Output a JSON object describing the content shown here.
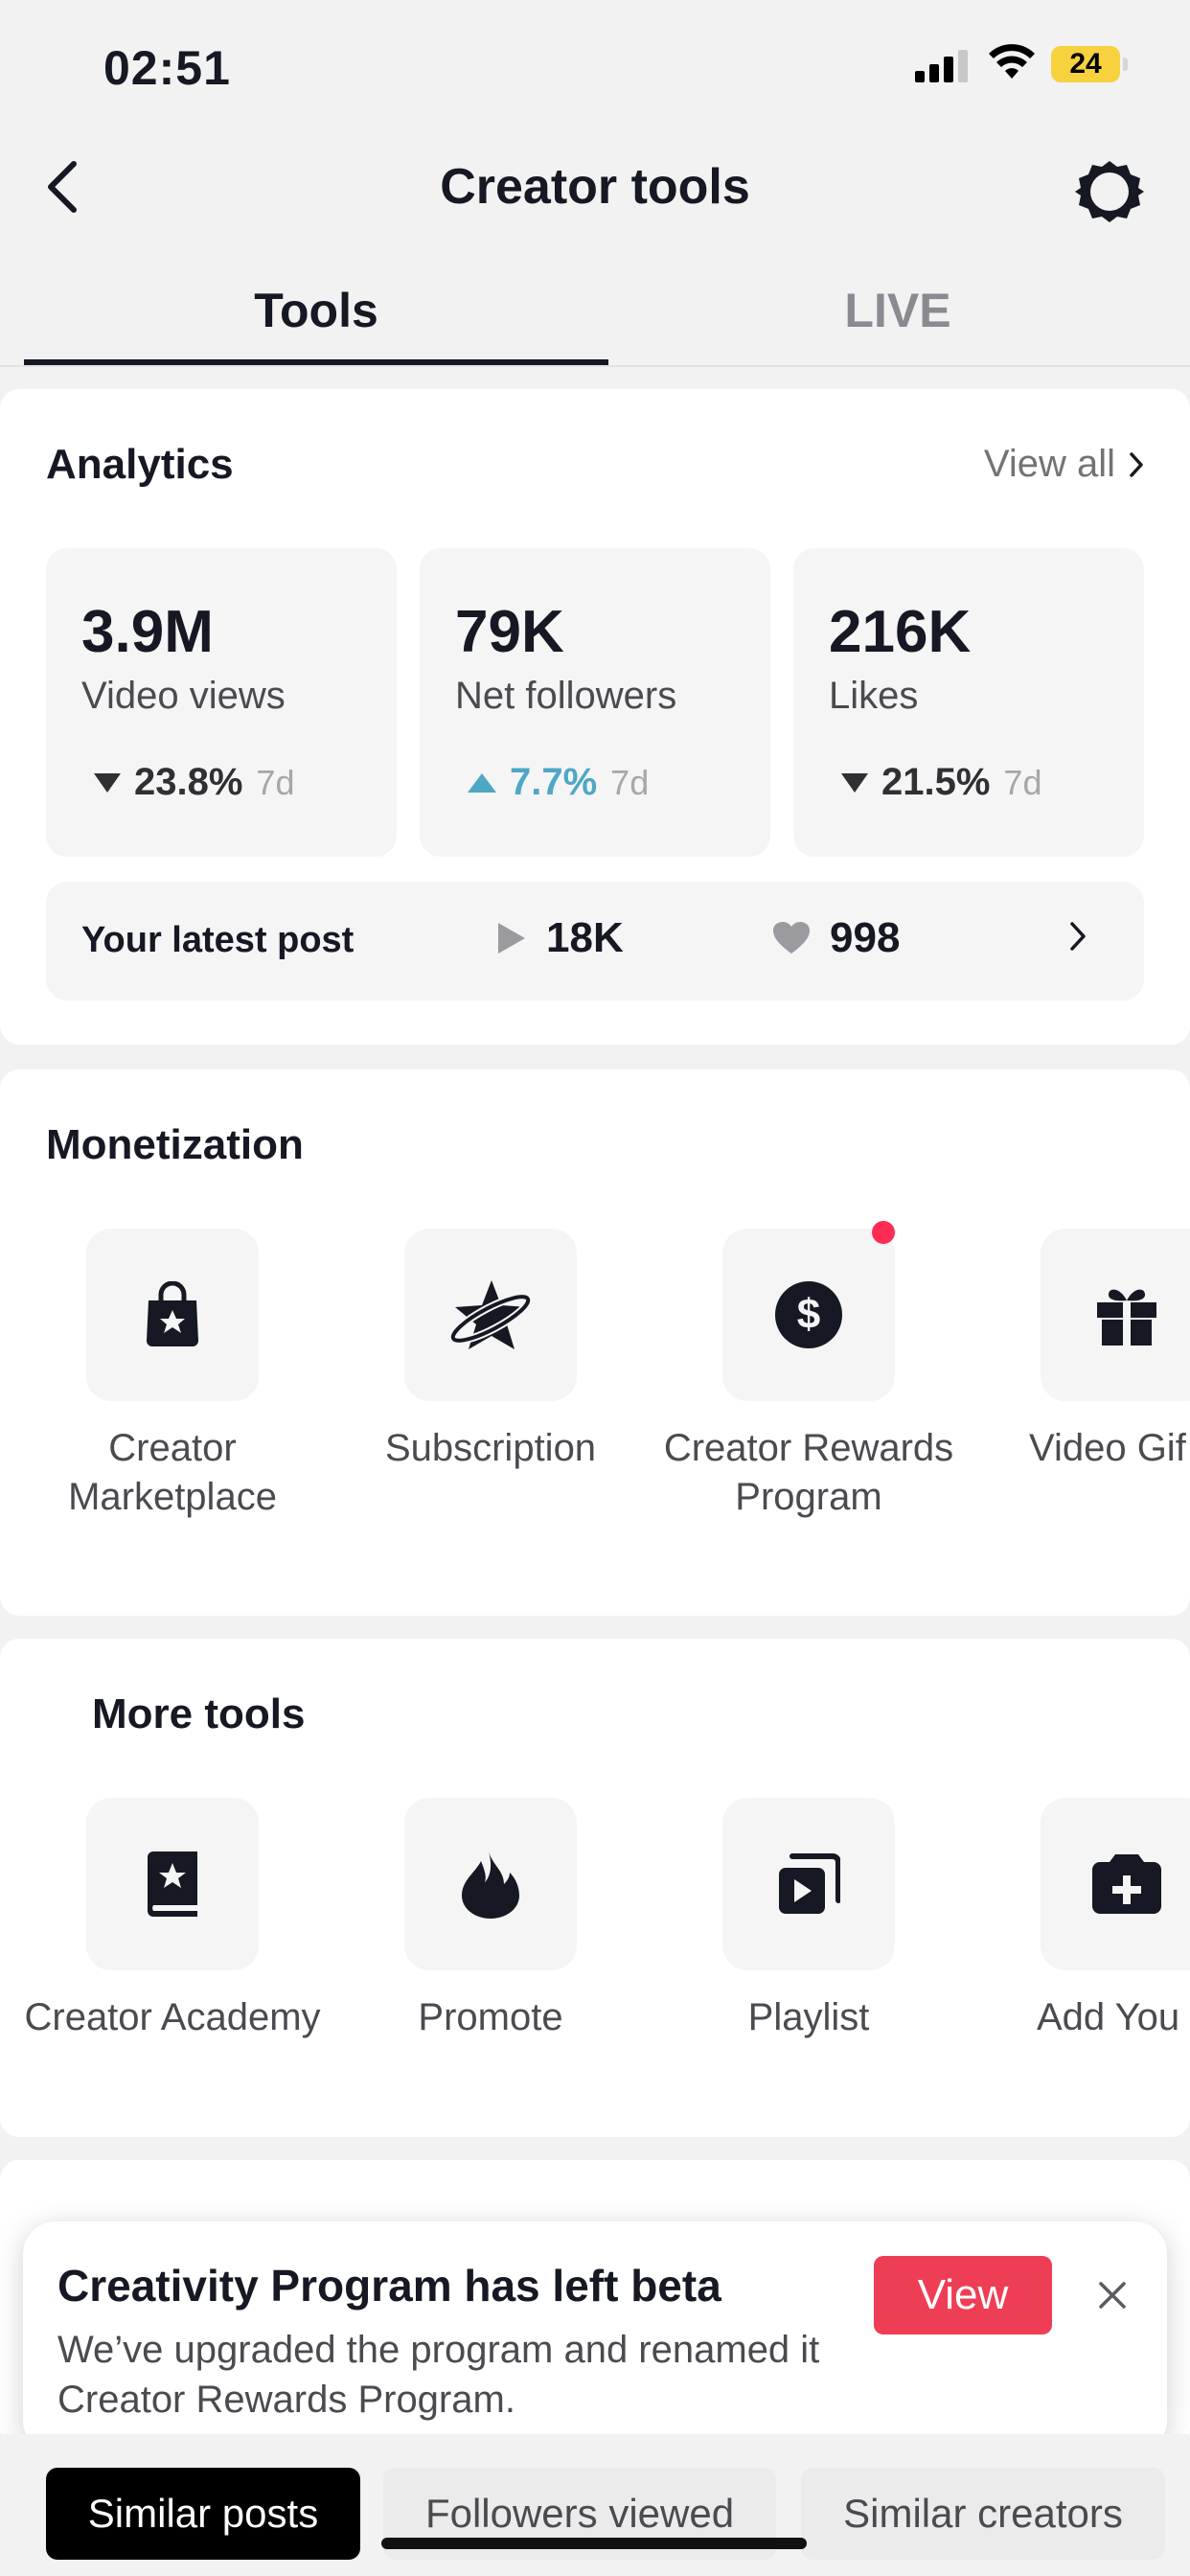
{
  "status_bar": {
    "time": "02:51",
    "battery": "24"
  },
  "header": {
    "title": "Creator tools"
  },
  "tabs": [
    {
      "label": "Tools",
      "active": true
    },
    {
      "label": "LIVE",
      "active": false
    }
  ],
  "analytics": {
    "title": "Analytics",
    "view_all": "View all",
    "stats": [
      {
        "value": "3.9M",
        "label": "Video views",
        "change": "23.8%",
        "direction": "down",
        "period": "7d"
      },
      {
        "value": "79K",
        "label": "Net followers",
        "change": "7.7%",
        "direction": "up",
        "period": "7d"
      },
      {
        "value": "216K",
        "label": "Likes",
        "change": "21.5%",
        "direction": "down",
        "period": "7d"
      }
    ],
    "latest_post": {
      "label": "Your latest post",
      "views": "18K",
      "likes": "998"
    }
  },
  "monetization": {
    "title": "Monetization",
    "items": [
      {
        "label": "Creator Marketplace",
        "icon": "shopping-bag-star-icon"
      },
      {
        "label": "Subscription",
        "icon": "star-planet-icon"
      },
      {
        "label": "Creator Rewards Program",
        "icon": "dollar-coin-icon",
        "badge": true
      },
      {
        "label": "Video Gif",
        "icon": "gift-icon"
      }
    ]
  },
  "more_tools": {
    "title": "More tools",
    "items": [
      {
        "label": "Creator Academy",
        "icon": "book-star-icon"
      },
      {
        "label": "Promote",
        "icon": "flame-icon"
      },
      {
        "label": "Playlist",
        "icon": "playlist-icon"
      },
      {
        "label": "Add You",
        "icon": "add-box-icon"
      }
    ]
  },
  "banner": {
    "title": "Creativity Program has left beta",
    "body": "We’ve upgraded the program and renamed it Creator Rewards Program.",
    "view_label": "View"
  },
  "bottom_chips": [
    {
      "label": "Similar posts",
      "active": true
    },
    {
      "label": "Followers viewed",
      "active": false
    },
    {
      "label": "Similar creators",
      "active": false
    }
  ],
  "colors": {
    "accent_red": "#ee3e55",
    "up_blue": "#4ea7c4",
    "battery_yellow": "#f7d23e"
  }
}
